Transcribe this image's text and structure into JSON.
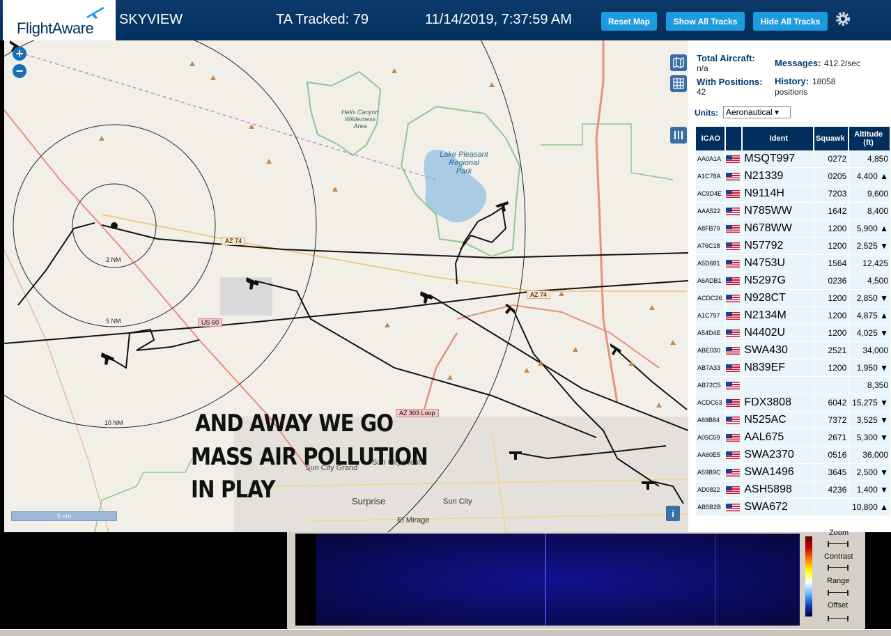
{
  "header": {
    "logo_text": "FlightAware",
    "site_name": "SKYVIEW",
    "tracked_label": "TA Tracked: 79",
    "datetime": "11/14/2019, 7:37:59 AM",
    "buttons": {
      "reset_map": "Reset Map",
      "show_all": "Show All Tracks",
      "hide_all": "Hide All Tracks"
    },
    "settings_icon": "gear-icon"
  },
  "map": {
    "zoom_in": "+",
    "zoom_out": "−",
    "range_rings": [
      "2 NM",
      "5 NM",
      "10 NM"
    ],
    "scale": "5 nm",
    "info": "i",
    "overlay_text": [
      "AND AWAY WE GO",
      "MASS AIR POLLUTION",
      "IN PLAY"
    ],
    "place_labels": {
      "hells_canyon": [
        "Hells Canyon",
        "Wilderness",
        "Area"
      ],
      "lake_pleasant": [
        "Lake Pleasant",
        "Regional",
        "Park"
      ],
      "sun_city_grand": "Sun City Grand",
      "sun_city_west": "Sun City West",
      "surprise": "Surprise",
      "sun_city": "Sun City",
      "el_mirage": "El Mirage"
    },
    "road_shields": {
      "az74_left": "AZ 74",
      "az74_right": "AZ 74",
      "us60": "US 60",
      "az303": "AZ 303 Loop"
    }
  },
  "stats": {
    "total_aircraft_label": "Total Aircraft:",
    "total_aircraft_value": "n/a",
    "with_positions_label": "With Positions:",
    "with_positions_value": "42",
    "messages_label": "Messages:",
    "messages_value": "412.2/sec",
    "history_label": "History:",
    "history_value": "18058",
    "history_unit": "positions",
    "units_label": "Units:",
    "units_value": "Aeronautical ▾"
  },
  "table": {
    "headers": {
      "icao": "ICAO",
      "ident": "Ident",
      "squawk": "Squawk",
      "altitude": "Altitude",
      "altitude_unit": "(ft)"
    },
    "rows": [
      {
        "icao": "AA0A1A",
        "ident": "MSQT997",
        "squawk": "0272",
        "alt": "4,850"
      },
      {
        "icao": "A1C78A",
        "ident": "N21339",
        "squawk": "0205",
        "alt": "4,400 ▲"
      },
      {
        "icao": "AC9D4E",
        "ident": "N9114H",
        "squawk": "7203",
        "alt": "9,600"
      },
      {
        "icao": "AAA522",
        "ident": "N785WW",
        "squawk": "1642",
        "alt": "8,400"
      },
      {
        "icao": "A8FB79",
        "ident": "N678WW",
        "squawk": "1200",
        "alt": "5,900 ▲"
      },
      {
        "icao": "A76C18",
        "ident": "N57792",
        "squawk": "1200",
        "alt": "2,525 ▼"
      },
      {
        "icao": "A5D681",
        "ident": "N4753U",
        "squawk": "1564",
        "alt": "12,425"
      },
      {
        "icao": "A6ADB1",
        "ident": "N5297G",
        "squawk": "0236",
        "alt": "4,500"
      },
      {
        "icao": "ACDC26",
        "ident": "N928CT",
        "squawk": "1200",
        "alt": "2,850 ▼"
      },
      {
        "icao": "A1C797",
        "ident": "N2134M",
        "squawk": "1200",
        "alt": "4,875 ▲"
      },
      {
        "icao": "A54D4E",
        "ident": "N4402U",
        "squawk": "1200",
        "alt": "4,025 ▼"
      },
      {
        "icao": "ABE030",
        "ident": "SWA430",
        "squawk": "2521",
        "alt": "34,000"
      },
      {
        "icao": "AB7A33",
        "ident": "N839EF",
        "squawk": "1200",
        "alt": "1,950 ▼"
      },
      {
        "icao": "AB72C5",
        "ident": "",
        "squawk": "",
        "alt": "8,350"
      },
      {
        "icao": "ACDC63",
        "ident": "FDX3808",
        "squawk": "6042",
        "alt": "15,275 ▼"
      },
      {
        "icao": "A69B84",
        "ident": "N525AC",
        "squawk": "7372",
        "alt": "3,525 ▼"
      },
      {
        "icao": "A05C59",
        "ident": "AAL675",
        "squawk": "2671",
        "alt": "5,300 ▼"
      },
      {
        "icao": "AA60E5",
        "ident": "SWA2370",
        "squawk": "0516",
        "alt": "36,000"
      },
      {
        "icao": "A59B9C",
        "ident": "SWA1496",
        "squawk": "3645",
        "alt": "2,500 ▼"
      },
      {
        "icao": "AD0822",
        "ident": "ASH5898",
        "squawk": "4236",
        "alt": "1,400 ▼"
      },
      {
        "icao": "AB5B2B",
        "ident": "SWA672",
        "squawk": "",
        "alt": "10,800 ▲"
      }
    ]
  },
  "spectrum": {
    "controls": [
      "Zoom",
      "Contrast",
      "Range",
      "Offset"
    ]
  },
  "colors": {
    "header_bg": "#002f5d",
    "button_bg": "#1e9be0",
    "table_header": "#002f5d",
    "row_bg": "#eaf4fb"
  }
}
